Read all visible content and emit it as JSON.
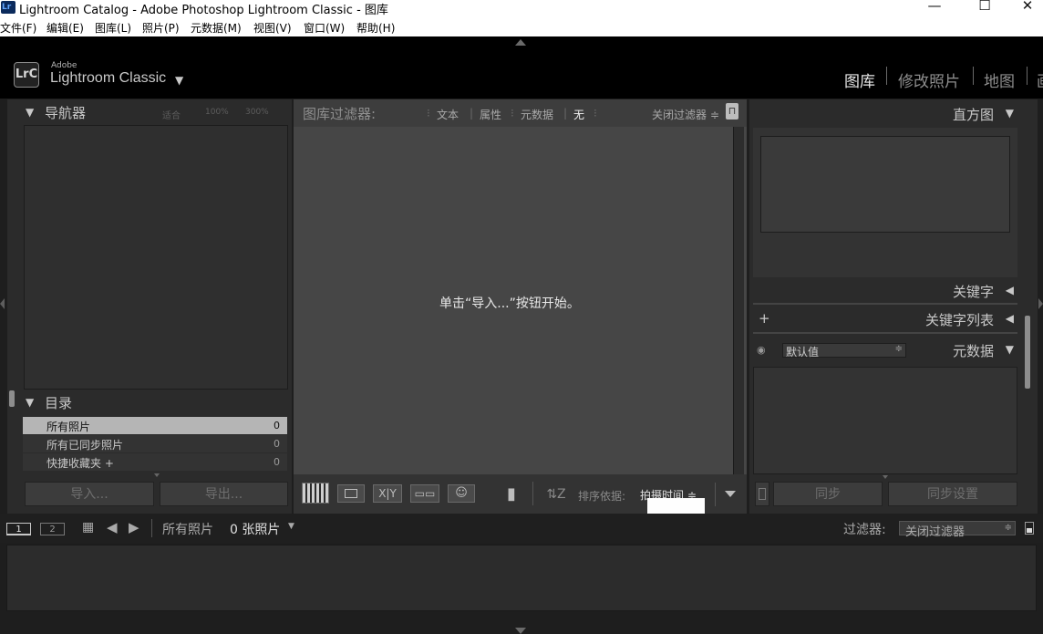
{
  "window": {
    "logo_text": "Lr",
    "title": "Lightroom Catalog - Adobe Photoshop Lightroom Classic - 图库",
    "minimize": "—",
    "maximize": "☐",
    "close": "✕"
  },
  "menubar": {
    "items": [
      "文件(F)",
      "编辑(E)",
      "图库(L)",
      "照片(P)",
      "元数据(M)",
      "视图(V)",
      "窗口(W)",
      "帮助(H)"
    ]
  },
  "identity": {
    "logo": "LrC",
    "vendor": "Adobe",
    "product": "Lightroom Classic",
    "dropdown": "▼"
  },
  "modules": {
    "items": [
      "图库",
      "修改照片",
      "地图",
      "画"
    ],
    "active": "图库"
  },
  "navigator": {
    "title": "导航器",
    "zoom_options": [
      "适合",
      "100%",
      "300%"
    ]
  },
  "catalog": {
    "title": "目录",
    "rows": [
      {
        "label": "所有照片",
        "count": "0"
      },
      {
        "label": "所有已同步照片",
        "count": "0"
      },
      {
        "label": "快捷收藏夹 +",
        "count": "0"
      }
    ]
  },
  "left_buttons": {
    "import": "导入...",
    "export": "导出..."
  },
  "filter_bar": {
    "title": "图库过滤器:",
    "options": [
      "文本",
      "属性",
      "元数据",
      "无"
    ],
    "active": "无",
    "preset": "关闭过滤器 ≑",
    "lock_icon": "🔓"
  },
  "main": {
    "empty_message": "单击“导入...”按钮开始。"
  },
  "toolbar": {
    "sort_label": "排序依据:",
    "sort_value": "拍摄时间 ≑"
  },
  "right_panels": {
    "histogram": "直方图",
    "keywords": "关键字",
    "keyword_list": "关键字列表",
    "keyword_add": "+",
    "metadata_preset": "默认值",
    "metadata": "元数据"
  },
  "right_buttons": {
    "sync": "同步",
    "sync_settings": "同步设置"
  },
  "filmstrip": {
    "view1": "1",
    "view2": "2",
    "source": "所有照片",
    "count": "0 张照片",
    "filter_label": "过滤器:",
    "filter_value": "关闭过滤器"
  },
  "colors": {
    "background": "#1e1e1e",
    "panel": "#2b2b2b",
    "content": "#464646",
    "text": "#c8c8c8",
    "selected_row": "#b5b5b5"
  }
}
